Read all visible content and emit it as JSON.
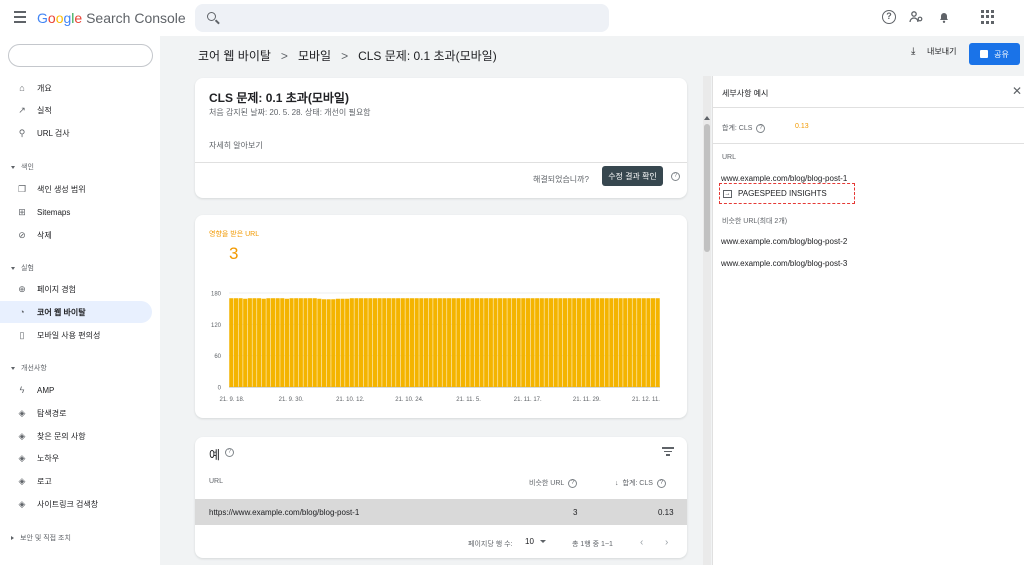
{
  "app": {
    "logo_google": "Google",
    "logo_product": "Search Console",
    "search_placeholder": ""
  },
  "sidebar": {
    "items": [
      {
        "label": "개요",
        "icon": "home-icon"
      },
      {
        "label": "실적",
        "icon": "trending-up-icon"
      },
      {
        "label": "URL 검사",
        "icon": "search-icon"
      }
    ],
    "index_section": "색인",
    "index_items": [
      {
        "label": "색인 생성 범위",
        "icon": "file-copy-icon"
      },
      {
        "label": "Sitemaps",
        "icon": "sitemap-icon"
      },
      {
        "label": "삭제",
        "icon": "visibility-off-icon"
      }
    ],
    "experience_section": "실험",
    "experience_items": [
      {
        "label": "페이지 경험",
        "icon": "plus-circle-icon"
      },
      {
        "label": "코어 웹 바이탈",
        "icon": "speed-gauge-icon",
        "active": true
      },
      {
        "label": "모바일 사용 편의성",
        "icon": "smartphone-icon"
      }
    ],
    "enhancements_section": "개선사항",
    "enhancements_items": [
      {
        "label": "AMP",
        "icon": "bolt-icon"
      },
      {
        "label": "탐색경로",
        "icon": "layers-icon"
      },
      {
        "label": "찾은 문의 사항",
        "icon": "layers-icon"
      },
      {
        "label": "노하우",
        "icon": "layers-icon"
      },
      {
        "label": "로고",
        "icon": "layers-icon"
      },
      {
        "label": "사이트링크 검색창",
        "icon": "layers-icon"
      }
    ],
    "security_section": "보안 및 직접 조치"
  },
  "breadcrumb": {
    "part1": "코어 웹 바이탈",
    "part2": "모바일",
    "part3": "CLS 문제: 0.1 초과(모바일)",
    "sep": ">"
  },
  "header_actions": {
    "export_label": "내보내기",
    "share_label": "공유"
  },
  "issue_card": {
    "title": "CLS 문제: 0.1 초과(모바일)",
    "meta": "처음 감지된 날짜: 20. 5. 28.   상태: 개선이 필요함",
    "learn_more": "자세히 알아보기",
    "resolved_question": "해결되었습니까?",
    "validate_button": "수정 결과 확인"
  },
  "chart_card": {
    "label": "영향을 받은 URL",
    "value": "3"
  },
  "chart_data": {
    "type": "bar",
    "title": "",
    "xlabel": "",
    "ylabel": "",
    "ylim": [
      0,
      180
    ],
    "yticks": [
      0,
      60,
      120,
      180
    ],
    "xtick_labels": [
      "21. 9. 18.",
      "21. 9. 30.",
      "21. 10. 12.",
      "21. 10. 24.",
      "21. 11. 5.",
      "21. 11. 17.",
      "21. 11. 29.",
      "21. 12. 11."
    ],
    "grid": true,
    "color": "#f4b400",
    "values": [
      170,
      170,
      170,
      169,
      170,
      170,
      170,
      169,
      170,
      170,
      170,
      170,
      169,
      170,
      170,
      170,
      170,
      170,
      170,
      169,
      168,
      168,
      168,
      169,
      169,
      169,
      170,
      170,
      170,
      170,
      170,
      170,
      170,
      170,
      170,
      170,
      170,
      170,
      170,
      170,
      170,
      170,
      170,
      170,
      170,
      170,
      170,
      170,
      170,
      170,
      170,
      170,
      170,
      170,
      170,
      170,
      170,
      170,
      170,
      170,
      170,
      170,
      170,
      170,
      170,
      170,
      170,
      170,
      170,
      170,
      170,
      170,
      170,
      170,
      170,
      170,
      170,
      170,
      170,
      170,
      170,
      170,
      170,
      170,
      170,
      170,
      170,
      170,
      170,
      170,
      170,
      170,
      170
    ]
  },
  "examples_card": {
    "title": "예",
    "col_url": "URL",
    "col_similar": "비슷한 URL",
    "col_total": "합계: CLS",
    "rows": [
      {
        "url": "https://www.example.com/blog/blog-post-1",
        "similar": "3",
        "total": "0.13"
      }
    ],
    "rows_per_page_label": "페이지당 행 수:",
    "rows_per_page_value": "10",
    "page_info": "총 1행 중 1~1"
  },
  "detail_panel": {
    "title": "세부사항 예시",
    "total_label": "합계: CLS",
    "total_value": "0.13",
    "url_header": "URL",
    "url_main": "www.example.com/blog/blog-post-1",
    "psi_label": "PAGESPEED INSIGHTS",
    "similar_header": "비슷한 URL(최대 2개)",
    "similar_urls": [
      "www.example.com/blog/blog-post-2",
      "www.example.com/blog/blog-post-3"
    ]
  }
}
